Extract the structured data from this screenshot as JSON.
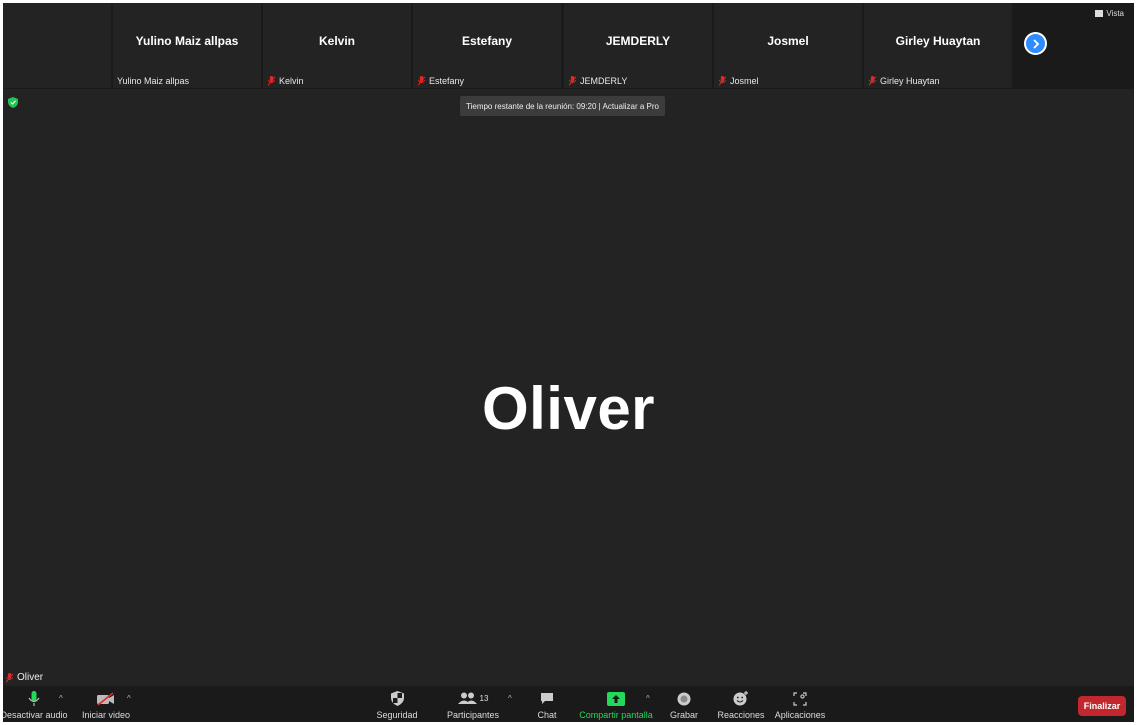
{
  "filmstrip": {
    "participants": [
      {
        "name": "Yulino Maiz allpas",
        "label": "Yulino Maiz allpas",
        "muted": false
      },
      {
        "name": "Kelvin",
        "label": "Kelvin",
        "muted": true
      },
      {
        "name": "Estefany",
        "label": "Estefany",
        "muted": true
      },
      {
        "name": "JEMDERLY",
        "label": "JEMDERLY",
        "muted": true
      },
      {
        "name": "Josmel",
        "label": "Josmel",
        "muted": true
      },
      {
        "name": "Girley Huaytan",
        "label": "Girley Huaytan",
        "muted": true
      }
    ],
    "view_label": "Vista"
  },
  "meeting": {
    "timer_text": "Tiempo restante de la reunión: 09:20 | Actualizar a Pro",
    "active_speaker": "Oliver",
    "speaker_label": "Oliver"
  },
  "toolbar": {
    "mute_label": "Desactivar audio",
    "video_label": "Iniciar video",
    "security_label": "Seguridad",
    "participants_label": "Participantes",
    "participants_count": "13",
    "chat_label": "Chat",
    "share_label": "Compartir pantalla",
    "record_label": "Grabar",
    "reactions_label": "Reacciones",
    "apps_label": "Aplicaciones",
    "end_label": "Finalizar",
    "caret": "^"
  },
  "colors": {
    "accent_blue": "#2d8cff",
    "share_green": "#23d959",
    "end_red": "#c1272d",
    "muted_red": "#e02828",
    "shield_green": "#23c552"
  }
}
